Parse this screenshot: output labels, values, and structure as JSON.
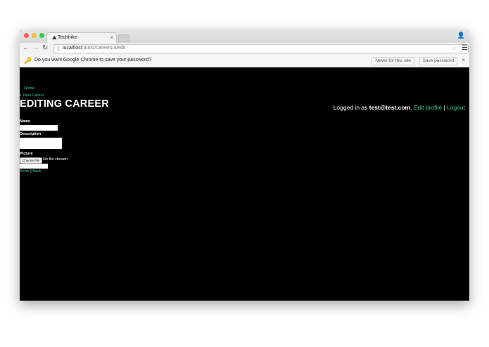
{
  "browser": {
    "tab_title": "Techhike",
    "tab_close": "×",
    "url_host": "localhost",
    "url_rest": ":3000/careers/4/edit"
  },
  "infobar": {
    "prompt": "Do you want Google Chrome to save your password?",
    "never_label": "Never for this site",
    "save_label": "Save password",
    "close": "×"
  },
  "page": {
    "nav_home": "Home",
    "nav_new_career": "New Career",
    "heading": "EDITING CAREER",
    "login_prefix": "Logged in as ",
    "login_email": "test@test.com",
    "login_dot": ".",
    "edit_profile": "Edit profile",
    "separator": "|",
    "logout": "Logout",
    "form": {
      "name_label": "Name",
      "name_value": "",
      "description_label": "Description",
      "description_value": "",
      "picture_label": "Picture",
      "choose_file": "Choose File",
      "no_file": "No file chosen",
      "submit_value": ""
    },
    "show_link": "Show",
    "back_link": "Back",
    "footer_sep": "|"
  },
  "colors": {
    "link": "#3ec98a",
    "page_bg": "#000000"
  }
}
